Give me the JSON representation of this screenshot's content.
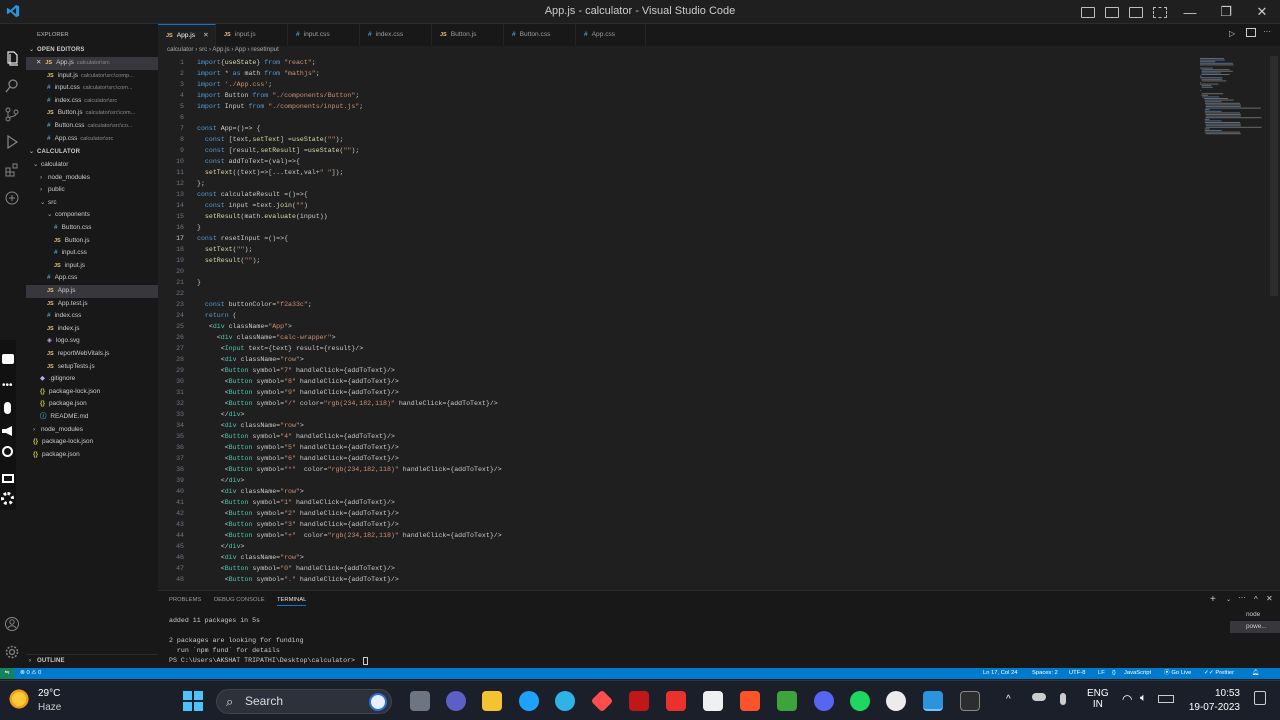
{
  "window": {
    "title": "App.js - calculator - Visual Studio Code"
  },
  "sidebar": {
    "explorer_label": "EXPLORER",
    "open_editors_label": "OPEN EDITORS",
    "open_editors": [
      {
        "name": "App.js",
        "path": "calculator\\src",
        "type": "js",
        "close": "✕"
      },
      {
        "name": "input.js",
        "path": "calculator\\src\\comp...",
        "type": "js"
      },
      {
        "name": "input.css",
        "path": "calculator\\src\\com...",
        "type": "css"
      },
      {
        "name": "index.css",
        "path": "calculator\\src",
        "type": "css"
      },
      {
        "name": "Button.js",
        "path": "calculator\\src\\com...",
        "type": "js"
      },
      {
        "name": "Button.css",
        "path": "calculator\\src\\co...",
        "type": "css"
      },
      {
        "name": "App.css",
        "path": "calculator\\src",
        "type": "css"
      }
    ],
    "calculator_label": "CALCULATOR",
    "tree": [
      {
        "name": "calculator",
        "indent": 1,
        "chev": "⌄"
      },
      {
        "name": "node_modules",
        "indent": 2,
        "chev": "›"
      },
      {
        "name": "public",
        "indent": 2,
        "chev": "›"
      },
      {
        "name": "src",
        "indent": 2,
        "chev": "⌄"
      },
      {
        "name": "components",
        "indent": 3,
        "chev": "⌄"
      },
      {
        "name": "Button.css",
        "indent": 4,
        "type": "css"
      },
      {
        "name": "Button.js",
        "indent": 4,
        "type": "js"
      },
      {
        "name": "input.css",
        "indent": 4,
        "type": "css"
      },
      {
        "name": "input.js",
        "indent": 4,
        "type": "js"
      },
      {
        "name": "App.css",
        "indent": 3,
        "type": "css"
      },
      {
        "name": "App.js",
        "indent": 3,
        "type": "js",
        "selected": true
      },
      {
        "name": "App.test.js",
        "indent": 3,
        "type": "js"
      },
      {
        "name": "index.css",
        "indent": 3,
        "type": "css"
      },
      {
        "name": "index.js",
        "indent": 3,
        "type": "js"
      },
      {
        "name": "logo.svg",
        "indent": 3,
        "type": "svg"
      },
      {
        "name": "reportWebVitals.js",
        "indent": 3,
        "type": "js"
      },
      {
        "name": "setupTests.js",
        "indent": 3,
        "type": "js"
      },
      {
        "name": ".gitignore",
        "indent": 2,
        "type": "git"
      },
      {
        "name": "package-lock.json",
        "indent": 2,
        "type": "json"
      },
      {
        "name": "package.json",
        "indent": 2,
        "type": "json"
      },
      {
        "name": "README.md",
        "indent": 2,
        "type": "md"
      },
      {
        "name": "node_modules",
        "indent": 1,
        "chev": "›"
      },
      {
        "name": "package-lock.json",
        "indent": 1,
        "type": "json"
      },
      {
        "name": "package.json",
        "indent": 1,
        "type": "json"
      }
    ],
    "outline_label": "OUTLINE"
  },
  "tabs": [
    {
      "label": "App.js",
      "type": "js",
      "active": true,
      "close": "✕"
    },
    {
      "label": "input.js",
      "type": "js"
    },
    {
      "label": "input.css",
      "type": "css"
    },
    {
      "label": "index.css",
      "type": "css"
    },
    {
      "label": "Button.js",
      "type": "js"
    },
    {
      "label": "Button.css",
      "type": "css"
    },
    {
      "label": "App.css",
      "type": "css"
    }
  ],
  "breadcrumb": [
    "calculator",
    "src",
    "App.js",
    "App",
    "resetInput"
  ],
  "code": [
    "import{useState} from \"react\";",
    "import * as math from \"mathjs\";",
    "import './App.css';",
    "import Button from \"./components/Button\";",
    "import Input from \"./components/input.js\";",
    "",
    "const App=()=> {",
    "  const [text,setText] =useState(\"\");",
    "  const [result,setResult] =useState(\"\");",
    "  const addToText=(val)=>{",
    "  setText((text)=>[...text,val+\" \"]);",
    "};",
    "const calculateResult =()=>{",
    "  const input =text.join(\"\")",
    "  setResult(math.evaluate(input))",
    "}",
    "const resetInput =()=>{",
    "  setText(\"\");",
    "  setResult(\"\");",
    "",
    "}",
    "",
    "  const buttonColor=\"f2a33c\";",
    "  return (",
    "   <div className=\"App\">",
    "     <div className=\"calc-wrapper\">",
    "      <Input text={text} result={result}/>",
    "      <div className=\"row\">",
    "      <Button symbol=\"7\" handleClick={addToText}/>",
    "       <Button symbol=\"8\" handleClick={addToText}/>",
    "       <Button symbol=\"9\" handleClick={addToText}/>",
    "       <Button symbol=\"/\" color=\"rgb(234,182,118)\" handleClick={addToText}/>",
    "      </div>",
    "      <div className=\"row\">",
    "      <Button symbol=\"4\" handleClick={addToText}/>",
    "       <Button symbol=\"5\" handleClick={addToText}/>",
    "       <Button symbol=\"6\" handleClick={addToText}/>",
    "       <Button symbol=\"*\"  color=\"rgb(234,182,118)\" handleClick={addToText}/>",
    "      </div>",
    "      <div className=\"row\">",
    "      <Button symbol=\"1\" handleClick={addToText}/>",
    "       <Button symbol=\"2\" handleClick={addToText}/>",
    "       <Button symbol=\"3\" handleClick={addToText}/>",
    "       <Button symbol=\"+\"  color=\"rgb(234,182,118)\" handleClick={addToText}/>",
    "      </div>",
    "      <div className=\"row\">",
    "      <Button symbol=\"0\" handleClick={addToText}/>",
    "       <Button symbol=\".\" handleClick={addToText}/>"
  ],
  "panel": {
    "tabs": [
      "PROBLEMS",
      "DEBUG CONSOLE",
      "TERMINAL"
    ],
    "terminal_lines": [
      "added 11 packages in 5s",
      "",
      "2 packages are looking for funding",
      "  run `npm fund` for details",
      "PS C:\\Users\\AKSHAT TRIPATHI\\Desktop\\calculator> "
    ],
    "terminals": [
      "node",
      "powe..."
    ],
    "plus": "+",
    "dots": "···",
    "caret": "^",
    "close": "✕"
  },
  "statusbar": {
    "left": "⊗ 0 ⚠ 0",
    "position": "Ln 17, Col 24",
    "spaces": "Spaces: 2",
    "encoding": "UTF-8",
    "eol": "LF",
    "braces": "{}",
    "language": "JavaScript",
    "golive": "Go Live",
    "prettier": "Prettier"
  },
  "taskbar": {
    "weather_temp": "29°C",
    "weather_desc": "Haze",
    "search_placeholder": "Search",
    "lang1": "ENG",
    "lang2": "IN",
    "time": "10:53",
    "date": "19-07-2023"
  },
  "colors": {
    "accent": "#007acc",
    "keyword": "#569cd6",
    "string": "#ce9178",
    "function": "#dcdcaa",
    "variable": "#9cdcfe",
    "tag": "#4ec9b0"
  }
}
